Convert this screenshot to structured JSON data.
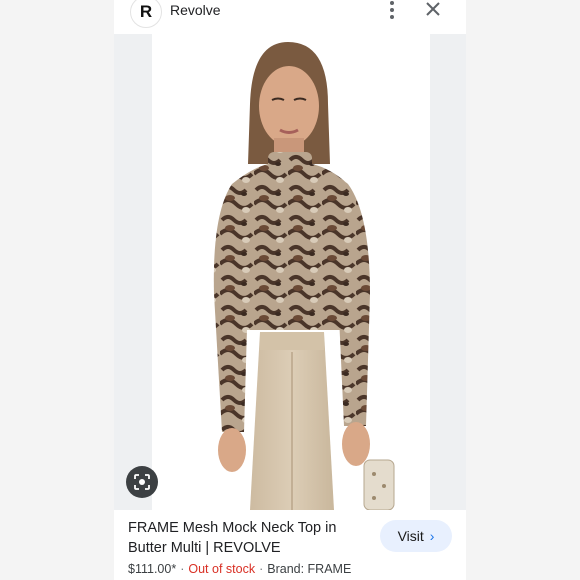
{
  "header": {
    "site_logo_letter": "R",
    "site_name": "Revolve"
  },
  "product": {
    "title": "FRAME Mesh Mock Neck Top in Butter Multi | REVOLVE",
    "price": "$111.00*",
    "stock_status": "Out of stock",
    "brand": "Brand: FRAME",
    "separator": "·"
  },
  "actions": {
    "visit_label": "Visit",
    "visit_chevron": "›"
  },
  "colors": {
    "accent": "#1a73e8",
    "visit_bg": "#e8f0fe",
    "stock_red": "#d93025"
  },
  "icons": [
    "more-vert-icon",
    "close-icon",
    "lens-icon",
    "chevron-right-icon"
  ]
}
